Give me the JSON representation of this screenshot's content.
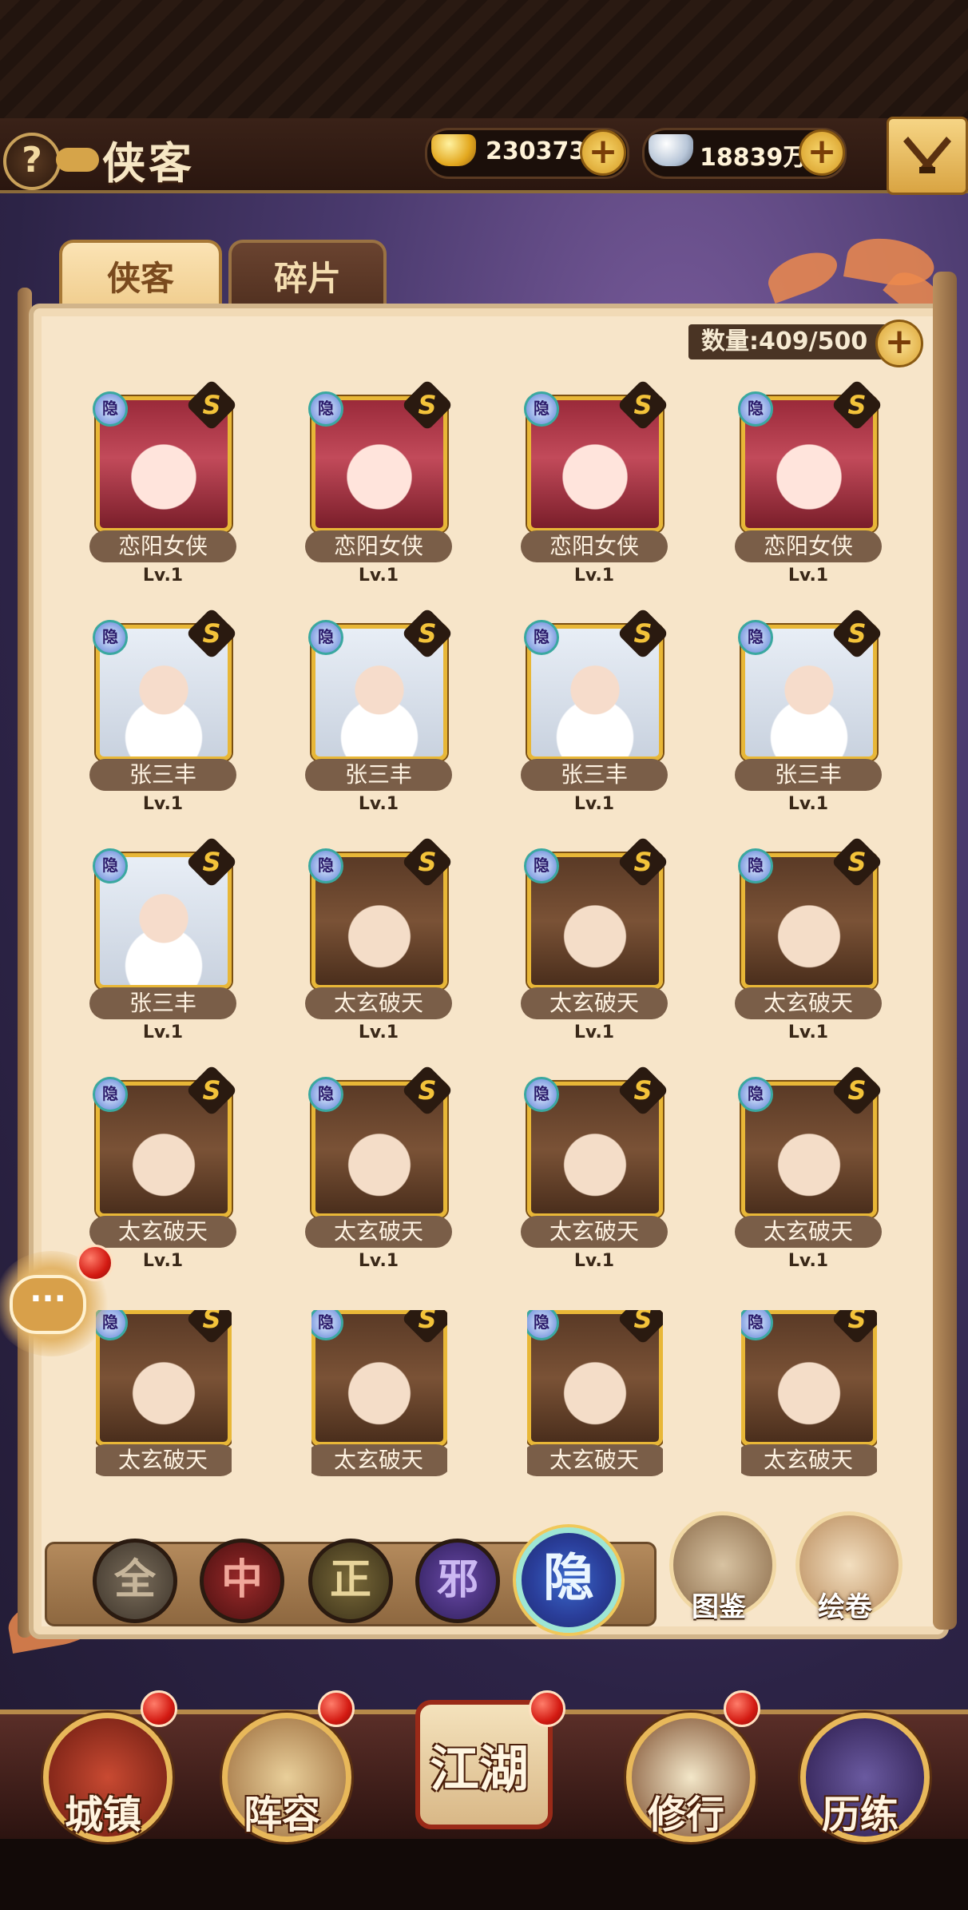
{
  "header": {
    "help_label": "?",
    "title": "侠客",
    "gold_value": "230373",
    "silver_value": "18839万",
    "plus_label": "+",
    "close_icon": "crossed-swords-icon"
  },
  "tabs": [
    {
      "label": "侠客",
      "active": true
    },
    {
      "label": "碎片",
      "active": false
    }
  ],
  "inventory": {
    "count_text": "数量:409/500"
  },
  "badges": {
    "yin": "隐",
    "rank": "S"
  },
  "heroes": [
    {
      "name": "恋阳女侠",
      "level": "Lv.1",
      "portrait": "female-heroine"
    },
    {
      "name": "恋阳女侠",
      "level": "Lv.1",
      "portrait": "female-heroine"
    },
    {
      "name": "恋阳女侠",
      "level": "Lv.1",
      "portrait": "female-heroine"
    },
    {
      "name": "恋阳女侠",
      "level": "Lv.1",
      "portrait": "female-heroine"
    },
    {
      "name": "张三丰",
      "level": "Lv.1",
      "portrait": "old-master"
    },
    {
      "name": "张三丰",
      "level": "Lv.1",
      "portrait": "old-master"
    },
    {
      "name": "张三丰",
      "level": "Lv.1",
      "portrait": "old-master"
    },
    {
      "name": "张三丰",
      "level": "Lv.1",
      "portrait": "old-master"
    },
    {
      "name": "张三丰",
      "level": "Lv.1",
      "portrait": "old-master"
    },
    {
      "name": "太玄破天",
      "level": "Lv.1",
      "portrait": "young-swordsman"
    },
    {
      "name": "太玄破天",
      "level": "Lv.1",
      "portrait": "young-swordsman"
    },
    {
      "name": "太玄破天",
      "level": "Lv.1",
      "portrait": "young-swordsman"
    },
    {
      "name": "太玄破天",
      "level": "Lv.1",
      "portrait": "young-swordsman"
    },
    {
      "name": "太玄破天",
      "level": "Lv.1",
      "portrait": "young-swordsman"
    },
    {
      "name": "太玄破天",
      "level": "Lv.1",
      "portrait": "young-swordsman"
    },
    {
      "name": "太玄破天",
      "level": "Lv.1",
      "portrait": "young-swordsman"
    },
    {
      "name": "太玄破天",
      "level": "",
      "portrait": "young-swordsman"
    },
    {
      "name": "太玄破天",
      "level": "",
      "portrait": "young-swordsman"
    },
    {
      "name": "太玄破天",
      "level": "",
      "portrait": "young-swordsman"
    },
    {
      "name": "太玄破天",
      "level": "",
      "portrait": "young-swordsman"
    }
  ],
  "filters": [
    {
      "label": "全",
      "active": false
    },
    {
      "label": "中",
      "active": false
    },
    {
      "label": "正",
      "active": false
    },
    {
      "label": "邪",
      "active": false
    },
    {
      "label": "隐",
      "active": true
    }
  ],
  "side_buttons": [
    {
      "label": "图鉴",
      "icon": "hero-catalog-icon"
    },
    {
      "label": "绘卷",
      "icon": "painting-scroll-icon"
    }
  ],
  "chat": {
    "icon_text": "···"
  },
  "bottom_nav": [
    {
      "label": "城镇",
      "icon": "town-gate-icon",
      "has_dot": true
    },
    {
      "label": "阵容",
      "icon": "straw-hat-warrior-icon",
      "has_dot": true
    },
    {
      "label": "江湖",
      "icon": "jianghu-scroll-icon",
      "has_dot": true
    },
    {
      "label": "修行",
      "icon": "training-scroll-icon",
      "has_dot": true
    },
    {
      "label": "历练",
      "icon": "trial-fire-icon",
      "has_dot": false
    }
  ],
  "colors": {
    "gold": "#e8b737",
    "panel": "#f7e5c9",
    "name_plate": "#7a5e48",
    "notification": "#d31a12"
  }
}
